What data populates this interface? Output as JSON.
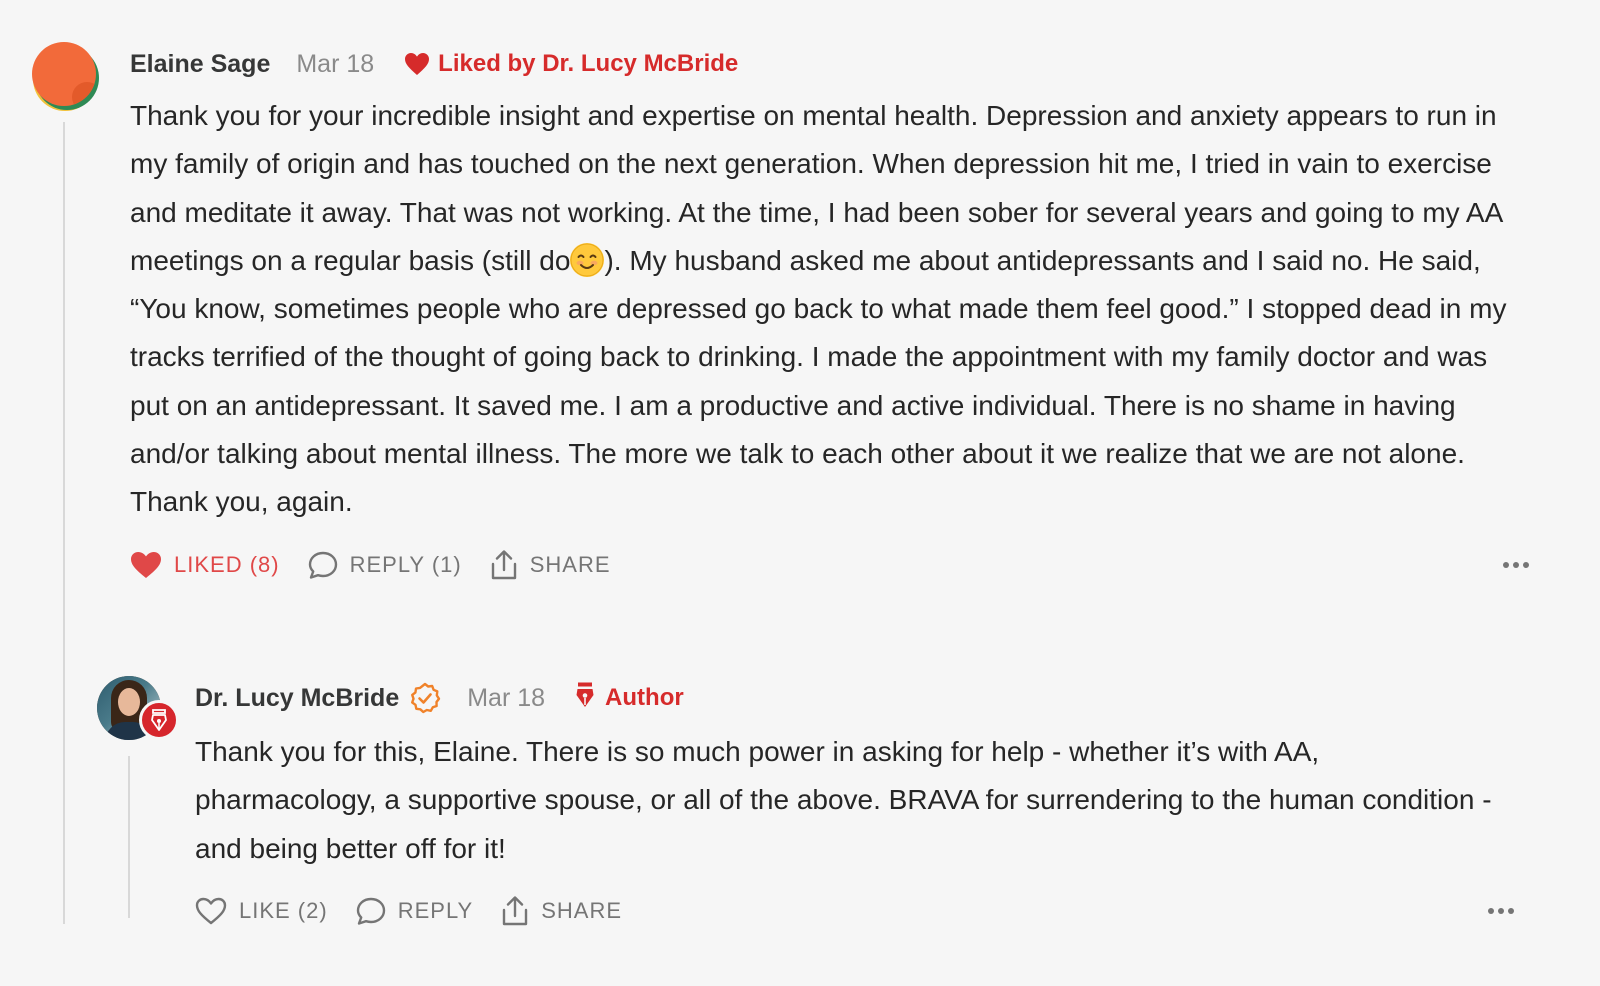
{
  "comments": [
    {
      "author": "Elaine Sage",
      "date": "Mar 18",
      "liked_by": "Liked by Dr. Lucy McBride",
      "text_before_emoji": "Thank you for your incredible insight and expertise on mental health. Depression and anxiety appears to run in my family of origin and has touched on the next generation. When depression hit me, I tried in vain to exercise and meditate it away. That was not working. At the time, I had been sober for several years and going to my AA meetings on a regular basis (still do",
      "emoji": "smiling-face-icon",
      "text_after_emoji": "). My husband asked me about antidepressants and I said no. He said, “You know, sometimes people who are depressed go back to what made them feel good.” I stopped dead in my tracks terrified of the thought of going back to drinking. I made the appointment with my family doctor and was put on an antidepressant. It saved me. I am a productive and active individual. There is no shame in having and/or talking about mental illness. The more we talk to each other about it we realize that we are not alone. Thank you, again.",
      "actions": {
        "like": "LIKED (8)",
        "reply": "REPLY (1)",
        "share": "SHARE"
      },
      "like_state": "liked"
    },
    {
      "author": "Dr. Lucy McBride",
      "date": "Mar 18",
      "tag": "Author",
      "text": "Thank you for this, Elaine. There is so much power in asking for help - whether it’s with AA, pharmacology, a supportive spouse, or all of the above. BRAVA for surrendering to the human condition - and being better off for it!",
      "actions": {
        "like": "LIKE (2)",
        "reply": "REPLY",
        "share": "SHARE"
      },
      "like_state": "not-liked"
    }
  ],
  "colors": {
    "background": "#f6f6f6",
    "accent_red": "#d62b2b",
    "liked_red": "#e04848",
    "verified_orange": "#f0822a",
    "muted_text": "#757575",
    "date_text": "#8a8a8a",
    "thread_line": "#d8d8d8"
  }
}
